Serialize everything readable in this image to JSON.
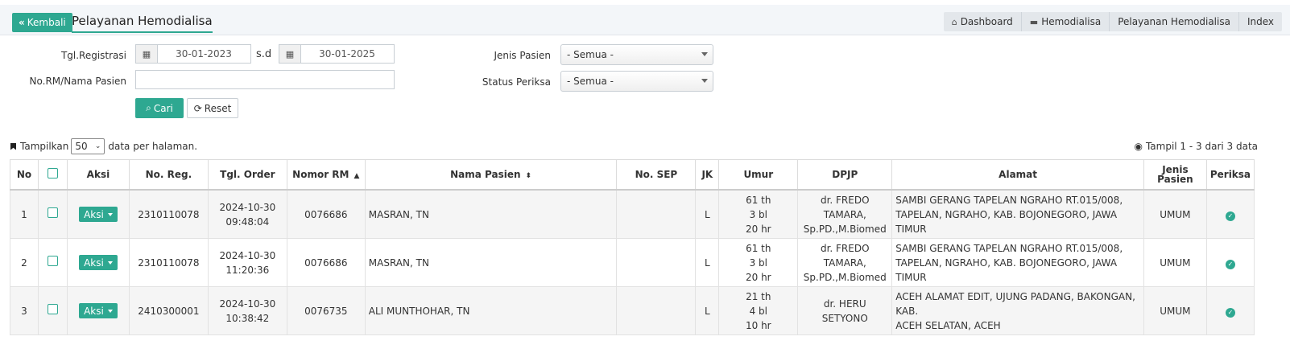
{
  "header": {
    "back_label": "Kembali",
    "title": "Pelayanan Hemodialisa",
    "breadcrumb": [
      {
        "label": "Dashboard",
        "icon": "home-icon"
      },
      {
        "label": "Hemodialisa",
        "icon": "folder-icon"
      },
      {
        "label": "Pelayanan Hemodialisa",
        "icon": ""
      },
      {
        "label": "Index",
        "icon": ""
      }
    ]
  },
  "filter": {
    "tgl_label": "Tgl.Registrasi",
    "date_from": "30-01-2023",
    "sd_label": "s.d",
    "date_to": "30-01-2025",
    "rm_label": "No.RM/Nama Pasien",
    "rm_value": "",
    "jenis_label": "Jenis Pasien",
    "jenis_value": "- Semua -",
    "status_label": "Status Periksa",
    "status_value": "- Semua -",
    "cari_label": "Cari",
    "reset_label": "Reset"
  },
  "listing": {
    "show_prefix": "Tampilkan",
    "per_page": "50",
    "show_suffix": "data per halaman.",
    "count_text": "Tampil 1 - 3 dari 3 data"
  },
  "table": {
    "headers": {
      "no": "No",
      "aksi": "Aksi",
      "noreg": "No. Reg.",
      "tgl_order": "Tgl. Order",
      "nomor_rm": "Nomor RM",
      "nama": "Nama Pasien",
      "sep": "No. SEP",
      "jk": "JK",
      "umur": "Umur",
      "dpjp": "DPJP",
      "alamat": "Alamat",
      "jenis": "Jenis Pasien",
      "periksa": "Periksa"
    },
    "rows": [
      {
        "no": "1",
        "aksi": "Aksi",
        "noreg": "2310110078",
        "tgl_date": "2024-10-30",
        "tgl_time": "09:48:04",
        "rm": "0076686",
        "nama": "MASRAN, TN",
        "sep": "",
        "jk": "L",
        "umur_th": "61 th",
        "umur_bl": "3 bl",
        "umur_hr": "20 hr",
        "dpjp_1": "dr. FREDO TAMARA,",
        "dpjp_2": "Sp.PD.,M.Biomed",
        "alamat_1": "SAMBI GERANG TAPELAN NGRAHO RT.015/008,",
        "alamat_2": "TAPELAN, NGRAHO, KAB. BOJONEGORO, JAWA TIMUR",
        "jenis": "UMUM"
      },
      {
        "no": "2",
        "aksi": "Aksi",
        "noreg": "2310110078",
        "tgl_date": "2024-10-30",
        "tgl_time": "11:20:36",
        "rm": "0076686",
        "nama": "MASRAN, TN",
        "sep": "",
        "jk": "L",
        "umur_th": "61 th",
        "umur_bl": "3 bl",
        "umur_hr": "20 hr",
        "dpjp_1": "dr. FREDO TAMARA,",
        "dpjp_2": "Sp.PD.,M.Biomed",
        "alamat_1": "SAMBI GERANG TAPELAN NGRAHO RT.015/008,",
        "alamat_2": "TAPELAN, NGRAHO, KAB. BOJONEGORO, JAWA TIMUR",
        "jenis": "UMUM"
      },
      {
        "no": "3",
        "aksi": "Aksi",
        "noreg": "2410300001",
        "tgl_date": "2024-10-30",
        "tgl_time": "10:38:42",
        "rm": "0076735",
        "nama": "ALI MUNTHOHAR, TN",
        "sep": "",
        "jk": "L",
        "umur_th": "21 th",
        "umur_bl": "4 bl",
        "umur_hr": "10 hr",
        "dpjp_1": "dr. HERU SETYONO",
        "dpjp_2": "",
        "alamat_1": "ACEH ALAMAT EDIT, UJUNG PADANG, BAKONGAN, KAB.",
        "alamat_2": "ACEH SELATAN, ACEH",
        "jenis": "UMUM"
      }
    ]
  },
  "colors": {
    "accent": "#2ea891"
  }
}
